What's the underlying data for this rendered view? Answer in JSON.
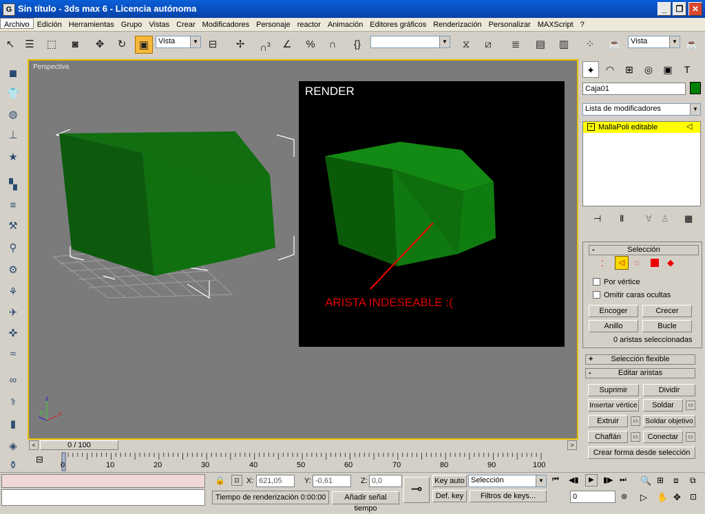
{
  "window": {
    "title": "Sin título - 3ds max 6 - Licencia autónoma",
    "app_icon": "3ds-max-icon"
  },
  "menu": [
    "Archivo",
    "Edición",
    "Herramientas",
    "Grupo",
    "Vistas",
    "Crear",
    "Modificadores",
    "Personaje",
    "reactor",
    "Animación",
    "Editores gráficos",
    "Renderización",
    "Personalizar",
    "MAXScript",
    "?"
  ],
  "toolbar": {
    "ref_coord": "Vista",
    "named_selection": "",
    "view_combo": "Vista",
    "snap_3": "3"
  },
  "viewport": {
    "label": "Perspectiva",
    "axis": {
      "x": "x",
      "y": "y",
      "z": "z"
    }
  },
  "render": {
    "title": "RENDER",
    "note": "ARISTA INDESEABLE :("
  },
  "panel": {
    "object_name": "Caja01",
    "object_color": "#008000",
    "modifier_list": "Lista de modificadores",
    "stack_item": "MallaPoli editable",
    "rollouts": {
      "seleccion": "Selección",
      "seleccion_flexible": "Selección flexible",
      "editar_aristas": "Editar aristas"
    },
    "checks": {
      "por_vertice": "Por vértice",
      "omitir": "Omitir caras ocultas"
    },
    "buttons": {
      "encoger": "Encoger",
      "crecer": "Crecer",
      "anillo": "Anillo",
      "bucle": "Bucle"
    },
    "status": "0 aristas seleccionadas",
    "edit": {
      "suprimir": "Suprimir",
      "dividir": "Dividir",
      "insertar": "Insertar vértice",
      "soldar": "Soldar",
      "extruir": "Extruir",
      "soldar_obj": "Soldar objetivo",
      "chaflan": "Chaflán",
      "conectar": "Conectar",
      "crear_forma": "Crear forma desde selección"
    }
  },
  "timeline": {
    "slider": "0 / 100",
    "ticks": [
      "0",
      "10",
      "20",
      "30",
      "40",
      "50",
      "60",
      "70",
      "80",
      "90",
      "100"
    ]
  },
  "status": {
    "x_label": "X:",
    "x": "621,05",
    "y_label": "Y:",
    "y": "-0,61",
    "z_label": "Z:",
    "z": "0,0",
    "render_time": "Tiempo de renderización  0:00:00",
    "add_tag": "Añadir señal tiempo",
    "key_auto": "Key auto",
    "def_key": "Def. key",
    "selection": "Selección",
    "filters": "Filtros de keys...",
    "frame": "0"
  }
}
